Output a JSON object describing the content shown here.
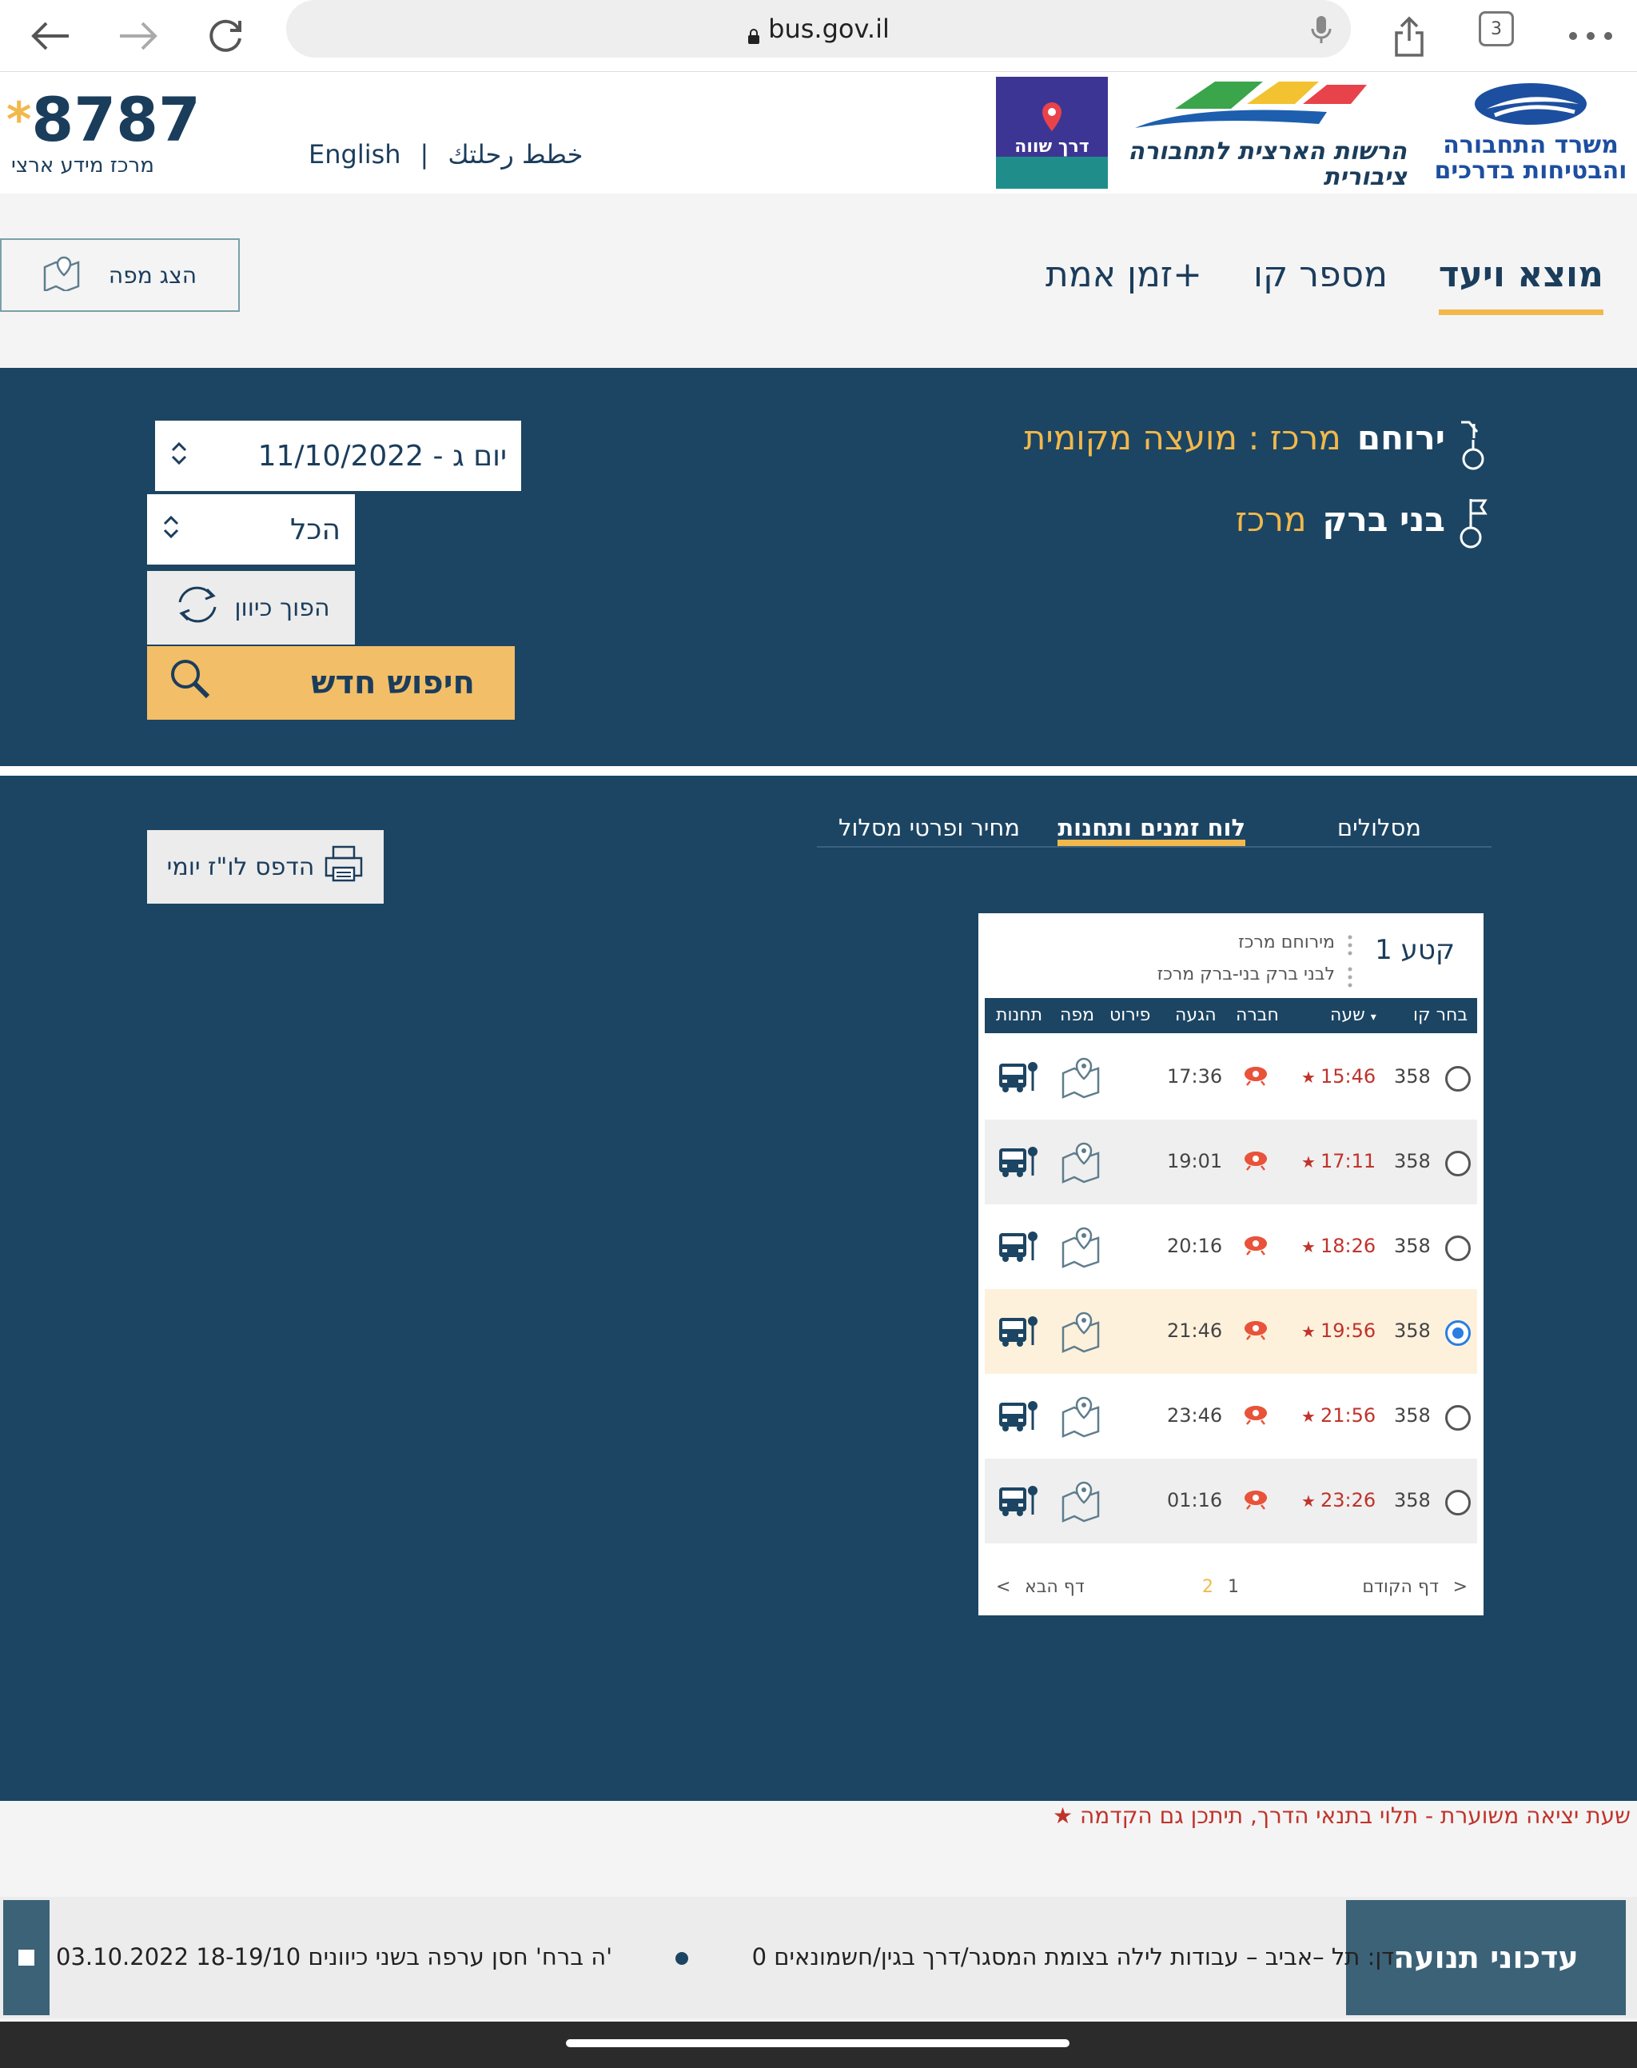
{
  "browser": {
    "url": "bus.gov.il",
    "tab_count": "3"
  },
  "header": {
    "hotline_number": "8787",
    "hotline_star": "*",
    "hotline_label": "מרכז מידע ארצי",
    "lang_english": "English",
    "lang_separator": "|",
    "lang_arabic": "خطط رحلتك",
    "nta_logo_text": "הרשות הארצית לתחבורה ציבורית",
    "ministry_logo_text": "משרד התחבורה והבטיחות בדרכים",
    "promo_text": "דרך שווה"
  },
  "tabs": {
    "origin_dest": "מוצא ויעד",
    "line_number": "מספר קו",
    "realtime": "זמן אמת+",
    "show_map": "הצג מפה"
  },
  "search": {
    "origin_name": "ירוחם",
    "origin_desc": "מרכז : מועצה מקומית",
    "dest_name": "בני ברק",
    "dest_desc": "מרכז",
    "date_value": "11/10/2022 - יום ג",
    "time_value": "הכל",
    "swap_label": "הפוך כיוון",
    "new_search_label": "חיפוש חדש"
  },
  "results": {
    "tabs": [
      "מסלולים",
      "לוח זמנים ותחנות",
      "מחיר ופרטי מסלול"
    ],
    "print_label": "הדפס לו\"ז יומי",
    "segment_title": "קטע 1",
    "segment_from": "מירוחם מרכז",
    "segment_to": "לבני ברק בני-ברק מרכז",
    "columns": {
      "choose": "בחר קו",
      "time": "שעה",
      "company": "חברה",
      "arrival": "הגעה",
      "details": "פירוט",
      "map": "מפה",
      "stops": "תחנות"
    },
    "rows": [
      {
        "line": "358",
        "departure": "15:46",
        "arrival": "17:36",
        "selected": false
      },
      {
        "line": "358",
        "departure": "17:11",
        "arrival": "19:01",
        "selected": false
      },
      {
        "line": "358",
        "departure": "18:26",
        "arrival": "20:16",
        "selected": false
      },
      {
        "line": "358",
        "departure": "19:56",
        "arrival": "21:46",
        "selected": true
      },
      {
        "line": "358",
        "departure": "21:56",
        "arrival": "23:46",
        "selected": false
      },
      {
        "line": "358",
        "departure": "23:26",
        "arrival": "01:16",
        "selected": false
      }
    ],
    "pager": {
      "prev": "דף הקודם",
      "next": "דף הבא",
      "page1": "1",
      "page2": "2",
      "prev_arrow": ">",
      "next_arrow": "<"
    }
  },
  "legend": {
    "text": "שעת יציאה משוערת - תלוי בתנאי הדרך, תיתכן גם הקדמה",
    "star": "★"
  },
  "ticker": {
    "label": "עדכוני תנועה",
    "item1": "'ה ברח' חסן ערפה בשני כיוונים 18-19/10",
    "item2": "03.10.2022 דן: תל –אביב – עבודות לילה בצומת המסגר/דרך בגין/חשמונאים 0"
  },
  "colors": {
    "navy": "#1c4563",
    "accent": "#f2b84b",
    "button_yellow": "#f2be68",
    "departure_red": "#c0332b",
    "selected_row": "#fdf1dc",
    "radio_blue": "#2b7de1"
  }
}
